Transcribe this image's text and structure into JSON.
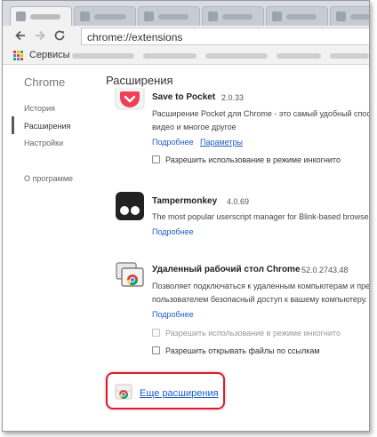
{
  "toolbar": {
    "back_icon": "back-arrow-icon",
    "forward_icon": "forward-arrow-icon",
    "reload_icon": "reload-icon",
    "url": "chrome://extensions"
  },
  "bookmarks": {
    "apps_label": "Сервисы"
  },
  "sidebar": {
    "title": "Chrome",
    "items": [
      {
        "label": "История"
      },
      {
        "label": "Расширения"
      },
      {
        "label": "Настройки"
      }
    ],
    "about": "О программе"
  },
  "main": {
    "title": "Расширения",
    "extensions": [
      {
        "name": "Save to Pocket",
        "version": "2.0.33",
        "description_line1": "Расширение Pocket для Chrome - это самый удобный спосо",
        "description_line2": "видео и многое другое",
        "details_link": "Подробнее",
        "options_link": "Параметры",
        "incognito_label": "Разрешить использование в режиме инкогнито"
      },
      {
        "name": "Tampermonkey",
        "version": "4.0.69",
        "description_line1": "The most popular userscript manager for Blink-based browser",
        "details_link": "Подробнее"
      },
      {
        "name": "Удаленный рабочий стол Chrome",
        "version": "52.0.2743.48",
        "description_line1": "Позволяет подключаться к удаленным компьютерам и пре",
        "description_line2": "пользователем безопасный доступ к вашему компьютеру.",
        "details_link": "Подробнее",
        "incognito_label": "Разрешить использование в режиме инкогнито",
        "file_urls_label": "Разрешить открывать файлы по ссылкам"
      }
    ],
    "more_extensions_link": "Еще расширения"
  },
  "colors": {
    "link": "#1a5cc6",
    "highlight_border": "#d41e2f",
    "pocket_red": "#ee4056"
  }
}
